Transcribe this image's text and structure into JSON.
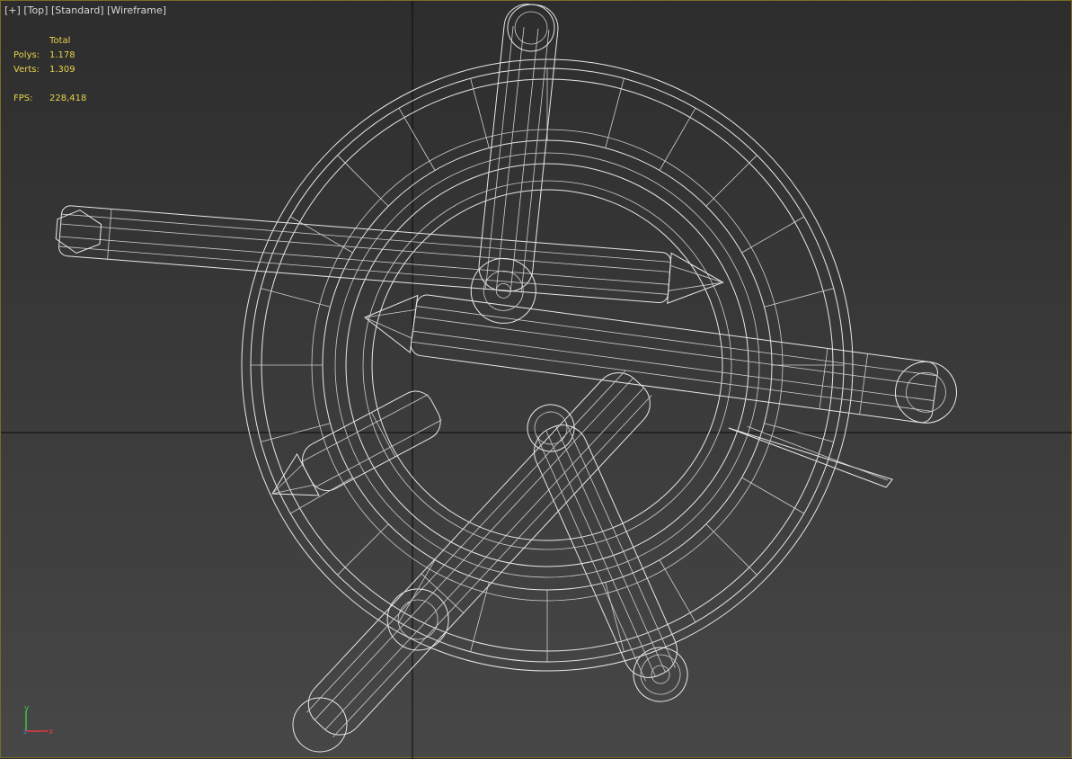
{
  "viewport": {
    "label": {
      "plus": "[+]",
      "view": "[Top]",
      "shading_style": "[Standard]",
      "render_mode": "[Wireframe]"
    },
    "stats": {
      "header": "Total",
      "polys_label": "Polys:",
      "polys_value": "1.178",
      "verts_label": "Verts:",
      "verts_value": "1.309",
      "fps_label": "FPS:",
      "fps_value": "228,418"
    },
    "axis_gizmo": {
      "x": "x",
      "y": "y",
      "z": "z"
    },
    "colors": {
      "stats_text": "#e5d24a",
      "wireframe": "#e8e8e8",
      "grid_axis": "#0a0a0a",
      "active_border": "#7a6a25"
    }
  }
}
